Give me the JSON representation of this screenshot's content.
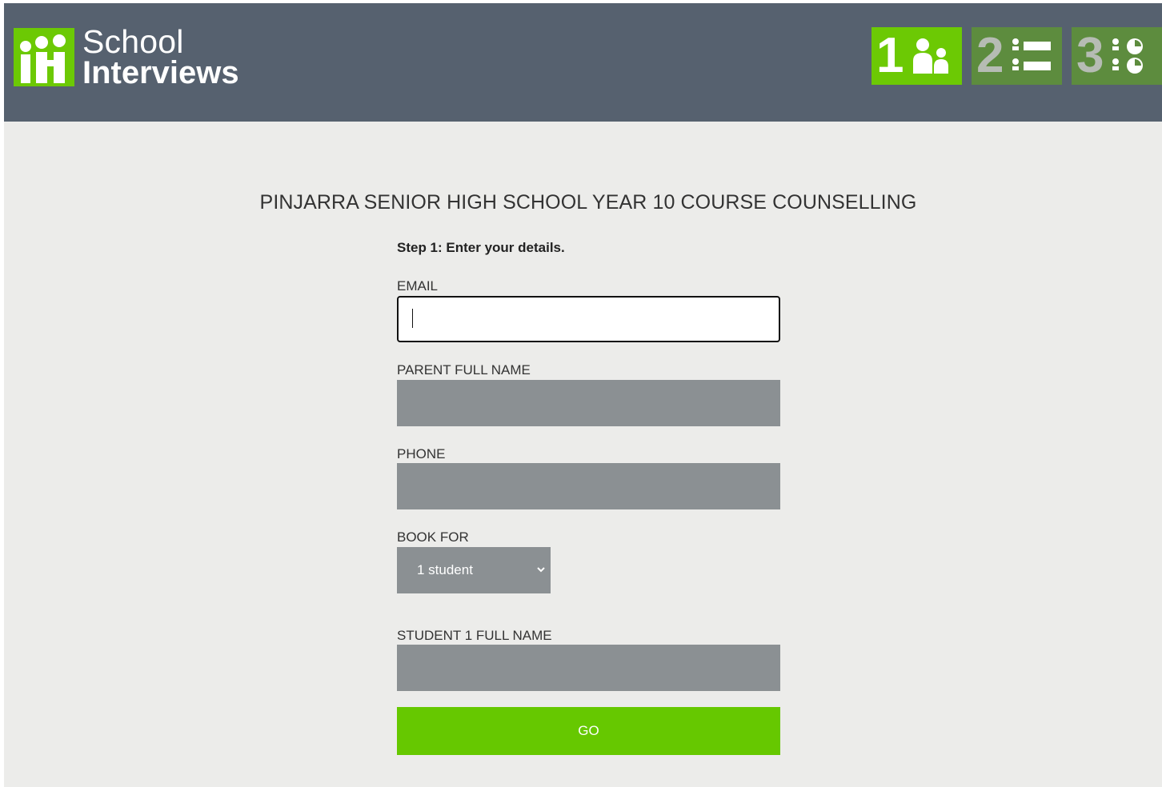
{
  "brand": {
    "line1": "School",
    "line2": "Interviews",
    "logo_icon": "people-logo-icon",
    "accent": "#6cc904"
  },
  "steps": [
    {
      "num": "1",
      "icon": "people-icon",
      "state": "active"
    },
    {
      "num": "2",
      "icon": "list-icon",
      "state": "inactive"
    },
    {
      "num": "3",
      "icon": "clock-list-icon",
      "state": "inactive"
    }
  ],
  "page_title": "PINJARRA SENIOR HIGH SCHOOL YEAR 10 COURSE COUNSELLING",
  "form": {
    "step_label": "Step 1: Enter your details.",
    "email_label": "EMAIL",
    "email_value": "",
    "parent_label": "PARENT FULL NAME",
    "parent_value": "",
    "phone_label": "PHONE",
    "phone_value": "",
    "book_for_label": "BOOK FOR",
    "book_for_value": "1 student",
    "student_label": "STUDENT 1 FULL NAME",
    "student_value": "",
    "go_label": "GO"
  }
}
